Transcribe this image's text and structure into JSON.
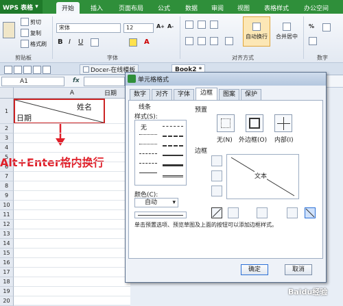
{
  "app": {
    "name": "WPS 表格"
  },
  "ribbon_tabs": [
    "开始",
    "插入",
    "页面布局",
    "公式",
    "数据",
    "审阅",
    "视图",
    "表格样式",
    "办公空间"
  ],
  "ribbon": {
    "cut": "剪切",
    "copy": "复制",
    "format_painter": "格式刷",
    "clipboard_label": "剪贴板",
    "font_name": "宋体",
    "font_size": "12",
    "font_label": "字体",
    "align_label": "对齐方式",
    "wrap_text": "自动换行",
    "merge_center": "合并居中",
    "number_label": "数字",
    "percent": "%"
  },
  "doc_tabs": {
    "docer": "Docer-在线模板",
    "book": "Book2 *"
  },
  "formula_bar": {
    "cell_ref": "A1",
    "fx": "fx"
  },
  "sheet": {
    "column_header": "A",
    "col_b_peek": "日期",
    "row_numbers": [
      "1",
      "2",
      "3",
      "4",
      "5",
      "6",
      "7",
      "8",
      "9",
      "10",
      "11",
      "12",
      "13",
      "14",
      "15",
      "16",
      "17",
      "18",
      "19",
      "20"
    ],
    "cell_a1_top": "姓名",
    "cell_a1_bottom": "日期"
  },
  "annotation": "Alt+Enter格内换行",
  "dialog": {
    "title": "单元格格式",
    "tabs": [
      "数字",
      "对齐",
      "字体",
      "边框",
      "图案",
      "保护"
    ],
    "active_tab": "边框",
    "line_group": "线条",
    "style_label": "样式(S):",
    "none_style": "无",
    "color_label": "颜色(C):",
    "color_value": "自动",
    "preset_group": "预置",
    "preset_none": "无(N)",
    "preset_outline": "外边框(O)",
    "preset_inside": "内部(I)",
    "border_group": "边框",
    "preview_text": "文本",
    "hint": "单击预置选项、预览草图及上面的按钮可以添加边框样式。",
    "ok": "确定",
    "cancel": "取消"
  },
  "watermark": "Baidu经验"
}
